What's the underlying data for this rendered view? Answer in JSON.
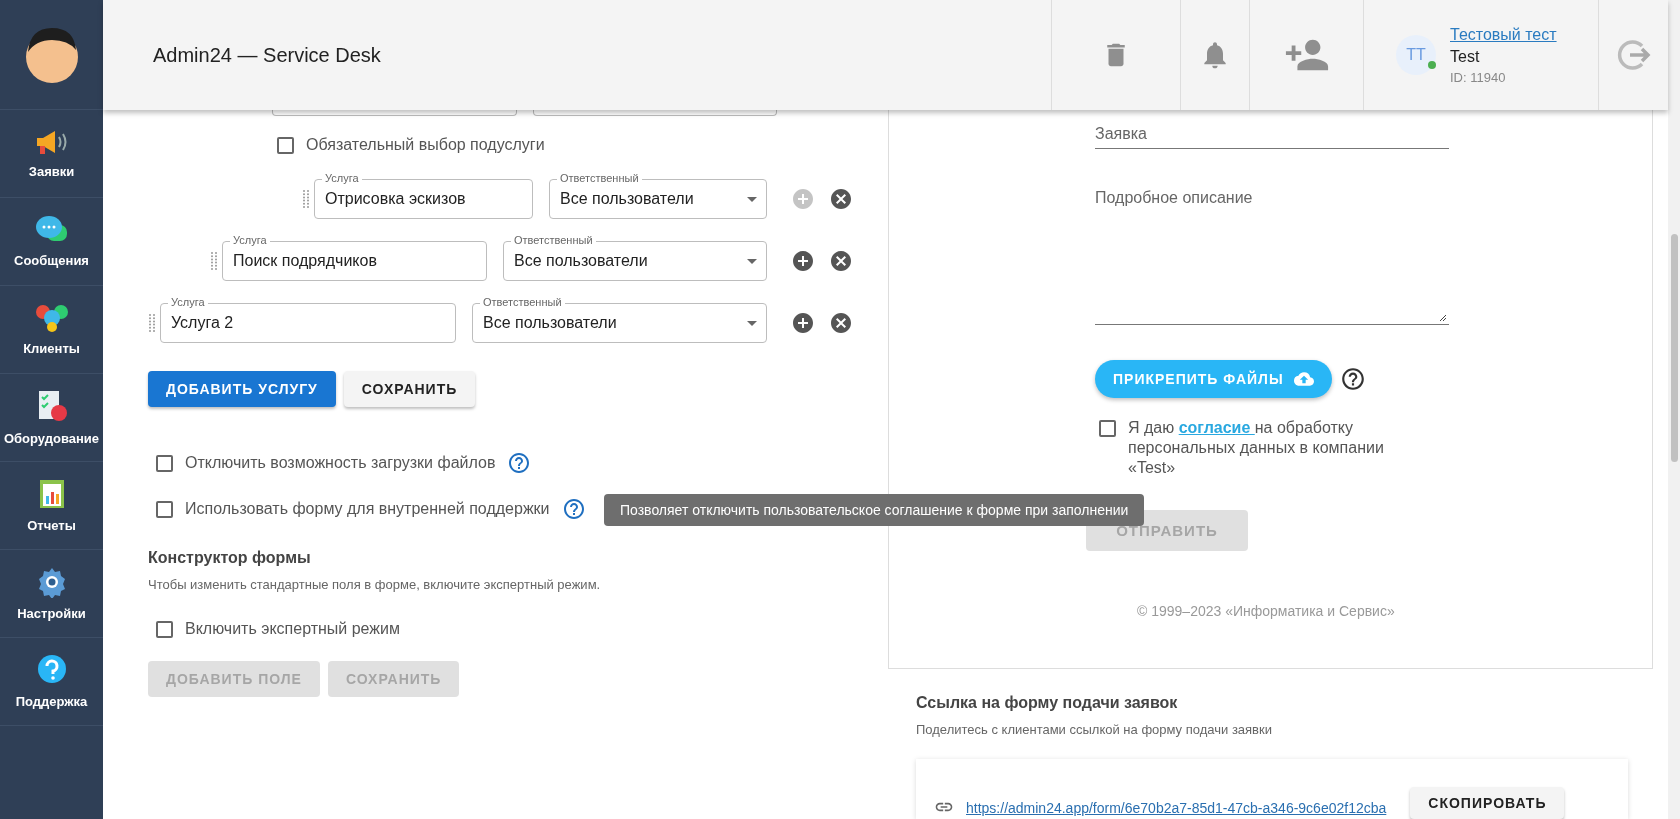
{
  "sidebar": {
    "items": [
      {
        "label": "Заявки"
      },
      {
        "label": "Сообщения"
      },
      {
        "label": "Клиенты"
      },
      {
        "label": "Оборудование"
      },
      {
        "label": "Отчеты"
      },
      {
        "label": "Настройки"
      },
      {
        "label": "Поддержка"
      }
    ]
  },
  "header": {
    "title": "Admin24 — Service Desk",
    "user": {
      "initials": "ТТ",
      "name": "Тестовый тест",
      "company": "Test",
      "id": "ID: 11940",
      "online": true
    }
  },
  "services": [
    {
      "name_label": "Услуга",
      "name": "Услуга 2",
      "responsible_label": "Ответственный",
      "responsible": "Все пользователи",
      "add_disabled": false,
      "children": [
        {
          "name_label": "Услуга",
          "name": "Поиск подрядчиков",
          "responsible_label": "Ответственный",
          "responsible": "Все пользователи",
          "add_disabled": false,
          "children": [
            {
              "required_subservice": {
                "label": "Обязательный выбор подуслуги",
                "checked": false
              },
              "children": [
                {
                  "name_label": "Услуга",
                  "name": "Отрисовка эскизов",
                  "responsible_label": "Ответственный",
                  "responsible": "Все пользователи",
                  "add_disabled": true
                }
              ]
            }
          ]
        }
      ]
    }
  ],
  "service_buttons": [
    {
      "label": "ДОБАВИТЬ УСЛУГУ",
      "kind": "primary"
    },
    {
      "label": "СОХРАНИТЬ",
      "kind": "plain"
    }
  ],
  "options": [
    {
      "label": "Отключить возможность загрузки файлов",
      "checked": false
    },
    {
      "label": "Использовать форму для внутренней поддержки",
      "checked": false
    }
  ],
  "tooltip": "Позволяет отключить пользовательское соглашение к форме при заполнении",
  "form_builder": {
    "title": "Конструктор формы",
    "hint": "Чтобы изменить стандартные поля в форме, включите экспертный режим.",
    "expert": {
      "label": "Включить экспертный режим",
      "checked": false
    },
    "buttons": [
      {
        "label": "ДОБАВИТЬ ПОЛЕ",
        "disabled": true
      },
      {
        "label": "СОХРАНИТЬ",
        "disabled": true
      }
    ]
  },
  "preview": {
    "fields": [
      {
        "kind": "line",
        "placeholder": "Заявка"
      },
      {
        "kind": "textarea",
        "placeholder": "Подробное описание"
      }
    ],
    "attach": "ПРИКРЕПИТЬ ФАЙЛЫ",
    "consent": {
      "before": "Я даю ",
      "link": "согласие ",
      "after": "на обработку персональных данных в компании «Test»",
      "checked": false
    },
    "submit": {
      "label": "ОТПРАВИТЬ",
      "disabled": true
    },
    "copyright": "© 1999–2023 «Информатика и Сервис»"
  },
  "share": {
    "title": "Ссылка на форму подачи заявок",
    "hint": "Поделитесь с клиентами ссылкой на форму подачи заявки",
    "url": "https://admin24.app/form/6e70b2a7-85d1-47cb-a346-9c6e02f12cba",
    "copy": "СКОПИРОВАТЬ"
  }
}
